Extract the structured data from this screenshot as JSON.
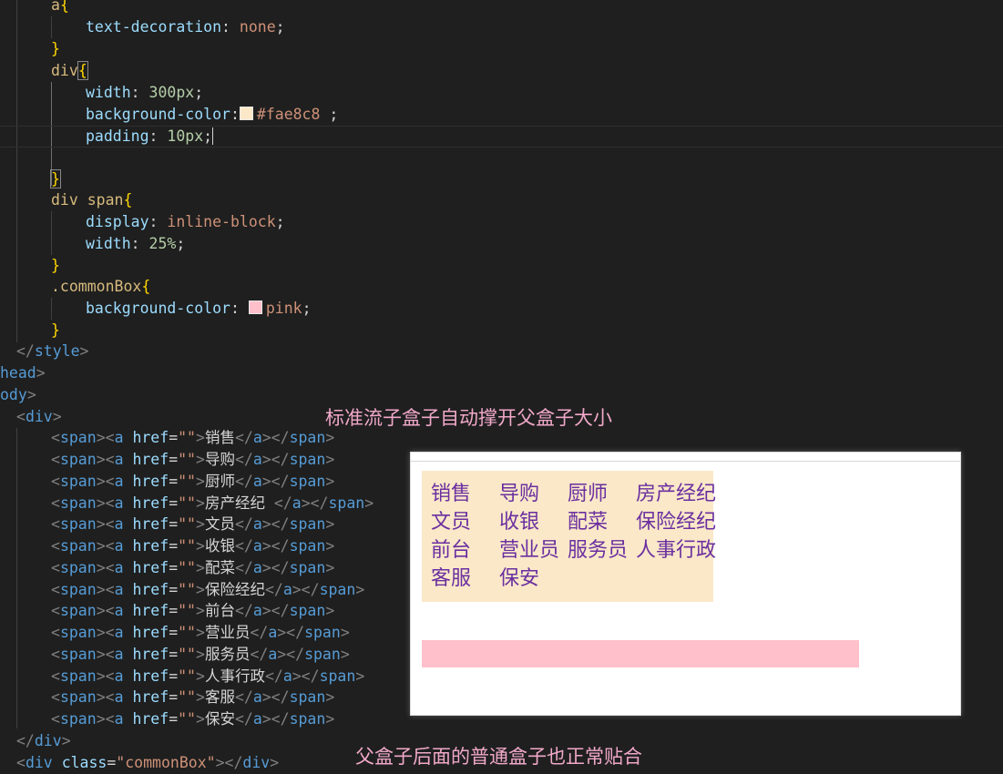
{
  "code": {
    "line_a_selector": "a",
    "brace_open": "{",
    "brace_close": "}",
    "prop_text_decoration": "text-decoration",
    "val_none": "none",
    "line_div_selector": "div",
    "prop_width": "width",
    "val_300px": "300px",
    "prop_background_color": "background-color",
    "val_fae8c8": "#fae8c8",
    "prop_padding": "padding",
    "val_10px": "10px",
    "line_div_span_selector": "div span",
    "prop_display": "display",
    "val_inline_block": "inline-block",
    "val_25": "25%",
    "line_commonbox_selector": ".commonBox",
    "val_pink": "pink",
    "style_close_tag": "style",
    "head_close_tag": "head",
    "body_open_tag": "ody",
    "div_tag": "div",
    "span_tag": "span",
    "a_tag": "a",
    "href_attr": "href",
    "empty_string": "\"\"",
    "class_attr": "class",
    "commonbox_string": "\"commonBox\""
  },
  "span_items": [
    "销售",
    "导购",
    "厨师",
    "房产经纪 ",
    "文员",
    "收银",
    "配菜",
    "保险经纪",
    "前台",
    "营业员",
    "服务员",
    "人事行政",
    "客服",
    "保安"
  ],
  "preview": {
    "jobs": [
      "销售",
      "导购",
      "厨师",
      "房产经纪",
      "文员",
      "收银",
      "配菜",
      "保险经纪",
      "前台",
      "营业员",
      "服务员",
      "人事行政",
      "客服",
      "保安"
    ]
  },
  "annotations": {
    "top": "标准流子盒子自动撑开父盒子大小",
    "bottom": "父盒子后面的普通盒子也正常贴合"
  },
  "colors": {
    "swatch_fae8c8": "#fae8c8",
    "swatch_pink": "#ffc0cb"
  }
}
